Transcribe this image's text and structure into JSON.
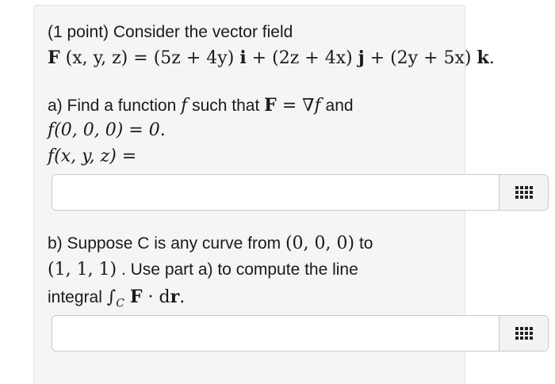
{
  "problem": {
    "intro": "(1 point) Consider the vector field",
    "field": {
      "lhs_F": "F",
      "lhs_args": "(x, y, z) = ",
      "i_coef": "(5z + 4y)",
      "i": "i",
      "j_coef": "(2z + 4x)",
      "j": "j",
      "k_coef": "(2y + 5x)",
      "k": "k",
      "plus": "+",
      "period": "."
    },
    "part_a": {
      "text1": "a) Find a function ",
      "f": "f",
      "text2": " such that ",
      "eq_F": "F",
      "eq_rest": " = ∇",
      "eq_f": "f",
      "text3": " and",
      "condition": "f(0, 0, 0) = 0.",
      "answer_label": "f(x, y, z) =",
      "answer_value": ""
    },
    "part_b": {
      "text1": "b) Suppose C is any curve from ",
      "from": "(0, 0, 0)",
      "text2": " to",
      "to": "(1, 1, 1)",
      "text3": " . Use part a) to compute the line",
      "text4": "integral ",
      "integral": "∫",
      "sub_C": "C",
      "int_F": "F",
      "dot": " · d",
      "int_r": "r",
      "period": ".",
      "answer_value": ""
    },
    "icons": {
      "equation_editor": "grid-icon"
    }
  }
}
